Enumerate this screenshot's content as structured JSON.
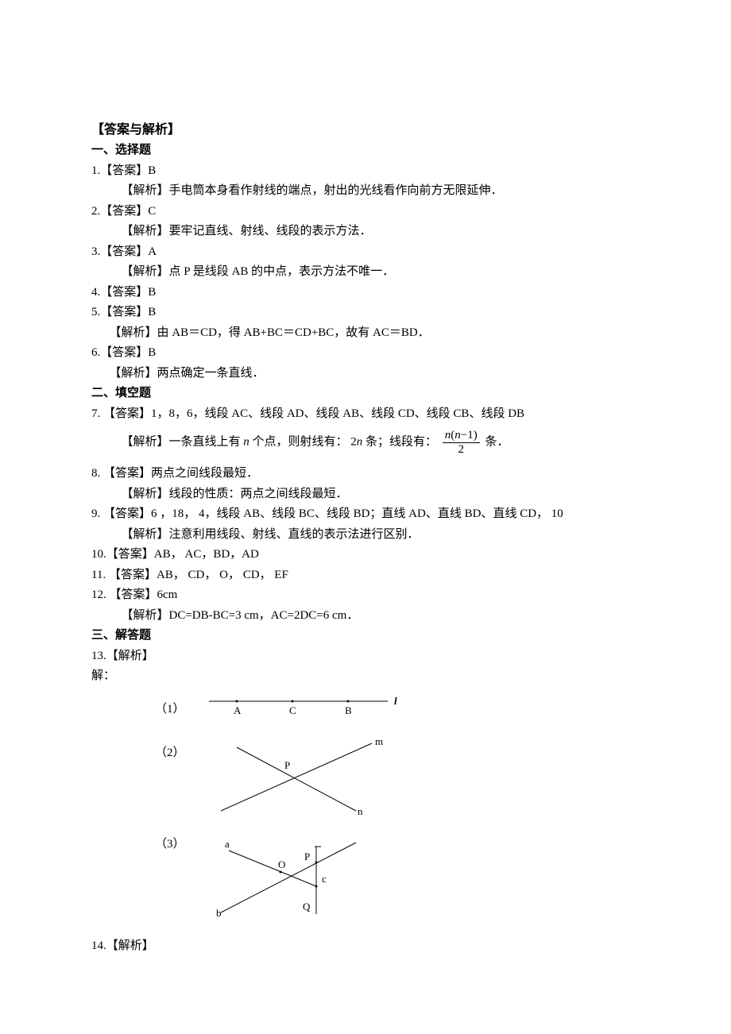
{
  "main_title": "【答案与解析】",
  "sections": {
    "s1": {
      "title": "一、选择题"
    },
    "s2": {
      "title": "二、填空题"
    },
    "s3": {
      "title": "三、解答题"
    }
  },
  "q1": {
    "line": "1.【答案】B",
    "analysis": "【解析】手电筒本身看作射线的端点，射出的光线看作向前方无限延伸．"
  },
  "q2": {
    "line": "2.【答案】C",
    "analysis": "【解析】要牢记直线、射线、线段的表示方法．"
  },
  "q3": {
    "line": "3.【答案】A",
    "analysis": "【解析】点 P 是线段 AB 的中点，表示方法不唯一．"
  },
  "q4": {
    "line": "4.【答案】B"
  },
  "q5": {
    "line": "5.【答案】B",
    "analysis": "【解析】由 AB＝CD，得 AB+BC＝CD+BC，故有 AC＝BD．"
  },
  "q6": {
    "line": "6.【答案】B",
    "analysis": "【解析】两点确定一条直线．"
  },
  "q7": {
    "line": "7.  【答案】1，8，6，线段 AC、线段 AD、线段 AB、线段 CD、线段 CB、线段 DB",
    "ana_pre": "【解析】一条直线上有",
    "ana_var1": "n",
    "ana_mid1": " 个点，则射线有：",
    "ana_var2": "2n",
    "ana_mid2": " 条；线段有：",
    "frac_nu": "n(n−1)",
    "frac_de": "2",
    "ana_post": " 条．"
  },
  "q8": {
    "line": "8.  【答案】两点之间线段最短．",
    "analysis": "【解析】线段的性质：两点之间线段最短．"
  },
  "q9": {
    "line": "9.  【答案】6 ，18，  4，线段 AB、线段 BC、线段 BD；直线 AD、直线 BD、直线 CD，    10",
    "analysis": "【解析】注意利用线段、射线、直线的表示法进行区别．"
  },
  "q10": {
    "line": "10.【答案】AB，  AC，BD，AD"
  },
  "q11": {
    "line": "11. 【答案】AB，    CD，    O，    CD，    EF"
  },
  "q12": {
    "line": "12. 【答案】6cm",
    "analysis": "【解析】DC=DB-BC=3 cm，AC=2DC=6 cm．"
  },
  "q13": {
    "line": "13.【解析】",
    "solve": "解：",
    "d1_label": "（1）",
    "d2_label": "（2）",
    "d3_label": "（3）",
    "d1": {
      "A": "A",
      "C": "C",
      "B": "B",
      "l": "l"
    },
    "d2": {
      "P": "P",
      "m": "m",
      "n": "n"
    },
    "d3": {
      "a": "a",
      "b": "b",
      "O": "O",
      "P": "P",
      "Q": "Q",
      "c": "c"
    }
  },
  "q14": {
    "line": "14.【解析】"
  }
}
